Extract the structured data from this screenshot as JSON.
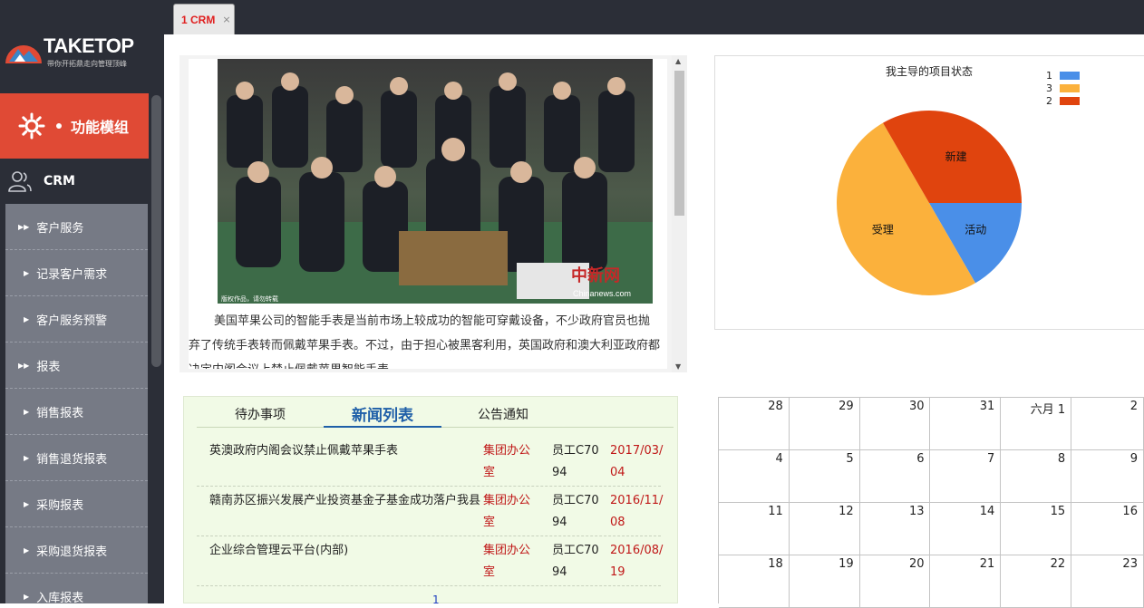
{
  "tabs": [
    {
      "label": "1 CRM",
      "close": "×"
    }
  ],
  "logo": {
    "text": "TAKETOP",
    "tagline": "带你开拓鼎走向管理顶峰"
  },
  "sidebar": {
    "module_label": "功能模组",
    "crm_label": "CRM",
    "items": [
      {
        "label": "客户服务",
        "type": "group"
      },
      {
        "label": "记录客户需求",
        "type": "sub"
      },
      {
        "label": "客户服务预警",
        "type": "sub"
      },
      {
        "label": "报表",
        "type": "group"
      },
      {
        "label": "销售报表",
        "type": "sub"
      },
      {
        "label": "销售退货报表",
        "type": "sub"
      },
      {
        "label": "采购报表",
        "type": "sub"
      },
      {
        "label": "采购退货报表",
        "type": "sub"
      },
      {
        "label": "入库报表",
        "type": "sub"
      }
    ]
  },
  "news_article": {
    "photo_caption": "版权作品，请勿转载",
    "watermark": "中新网 Chinanews.com",
    "text": "美国苹果公司的智能手表是当前市场上较成功的智能可穿戴设备，不少政府官员也抛弃了传统手表转而佩戴苹果手表。不过，由于担心被黑客利用，英国政府和澳大利亚政府都决定内阁会议上禁止佩戴苹果智能手表。"
  },
  "chart_data": {
    "type": "pie",
    "title": "我主导的项目状态",
    "legend": [
      "1",
      "3",
      "2"
    ],
    "slices": [
      {
        "label": "活动",
        "legend": "1",
        "value": 1,
        "color": "#4a8fe8"
      },
      {
        "label": "受理",
        "legend": "3",
        "value": 3,
        "color": "#fbb13c"
      },
      {
        "label": "新建",
        "legend": "2",
        "value": 2,
        "color": "#e0440e"
      }
    ]
  },
  "info_tabs": {
    "tabs": [
      "待办事项",
      "新闻列表",
      "公告通知"
    ],
    "active": 1,
    "rows": [
      {
        "title": "英澳政府内阁会议禁止佩戴苹果手表",
        "dept": "集团办公室",
        "staff": "员工C7094",
        "date": "2017/03/04"
      },
      {
        "title": "赣南苏区振兴发展产业投资基金子基金成功落户我县",
        "dept": "集团办公室",
        "staff": "员工C7094",
        "date": "2016/11/08"
      },
      {
        "title": "企业综合管理云平台(内部)",
        "dept": "集团办公室",
        "staff": "员工C7094",
        "date": "2016/08/19"
      }
    ],
    "page": "1"
  },
  "calendar": {
    "weeks": [
      [
        "28",
        "29",
        "30",
        "31",
        "六月 1",
        "2"
      ],
      [
        "4",
        "5",
        "6",
        "7",
        "8",
        "9"
      ],
      [
        "11",
        "12",
        "13",
        "14",
        "15",
        "16"
      ],
      [
        "18",
        "19",
        "20",
        "21",
        "22",
        "23"
      ]
    ]
  }
}
